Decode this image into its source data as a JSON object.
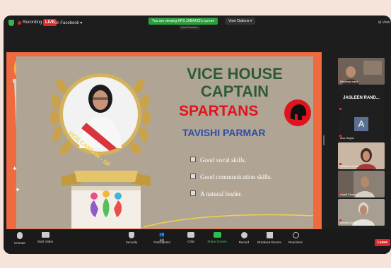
{
  "meeting": {
    "recording": "Recording",
    "live": "LIVE",
    "on_facebook": "on Facebook",
    "viewing_banner": "You are viewing KPS JABAKIS's screen",
    "view_options": "View Options",
    "host_label": "Host Preview",
    "view_label": "View"
  },
  "slide": {
    "title_line1": "VICE HOUSE",
    "title_line2": "CAPTAIN",
    "house": "SPARTANS",
    "name": "TAVISHI PARMAR",
    "sash": "VICE CAPTAIN - SP",
    "bullets": [
      "Good vocal skills.",
      "Good communication skills.",
      "A natural leader."
    ],
    "colors": {
      "title": "#2d5a3d",
      "house": "#e0141e",
      "name": "#2c4fa6",
      "frame": "#ef6a3f",
      "panel": "#b0a594"
    }
  },
  "participants": [
    {
      "name": "Pardeep walia",
      "type": "video"
    },
    {
      "name": "JASLEEN RAND...",
      "type": "name"
    },
    {
      "name": "Anu Dogra",
      "type": "avatar",
      "initial": "A"
    },
    {
      "name": "Gurleen Mehta",
      "type": "video"
    },
    {
      "name": "Anjali Chopra",
      "type": "video"
    },
    {
      "name": "Mamta Chop...",
      "type": "video"
    }
  ],
  "toolbar": {
    "unmute": "Unmute",
    "start_video": "Start Video",
    "security": "Security",
    "participants": "Participants",
    "participants_count": "40",
    "chat": "Chat",
    "share_screen": "Share Screen",
    "record": "Record",
    "breakout_rooms": "Breakout Rooms",
    "reactions": "Reactions",
    "leave": "Leave"
  }
}
